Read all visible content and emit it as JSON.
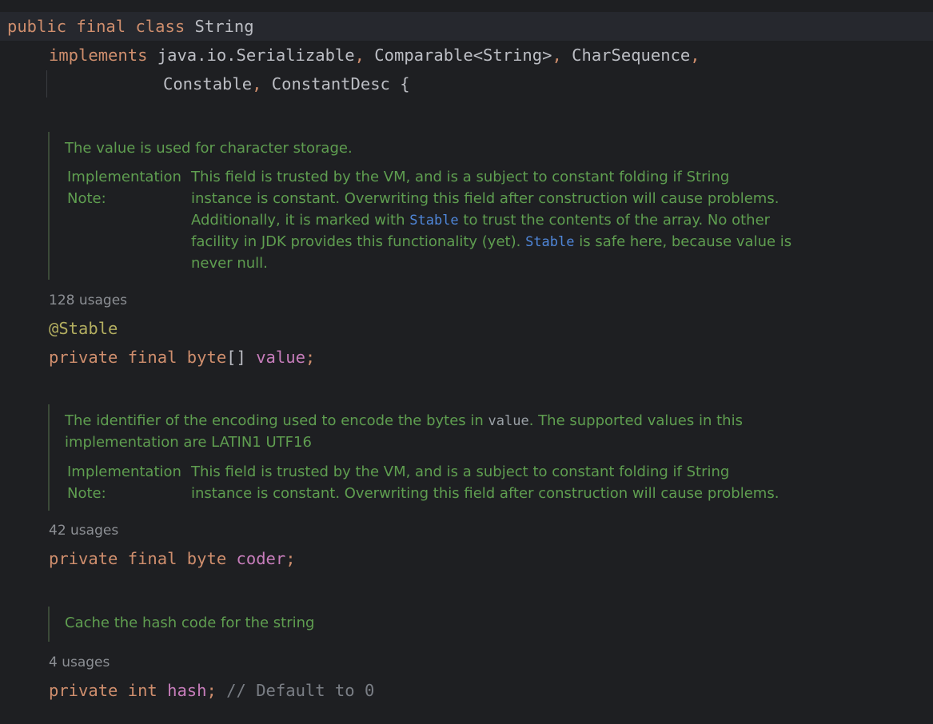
{
  "class_decl": {
    "line1": {
      "kw": "public final class",
      "name": "String"
    },
    "line2": {
      "kw": "implements",
      "types": [
        "java.io.Serializable",
        "Comparable<String>",
        "CharSequence"
      ],
      "comma": ","
    },
    "line3": {
      "types": [
        "Constable",
        "ConstantDesc"
      ],
      "comma": ",",
      "brace": "{"
    }
  },
  "doc_value": {
    "summary": "The value is used for character storage.",
    "impl_label_1": "Implementation",
    "impl_label_2": "Note:",
    "lines": [
      "This field is trusted by the VM, and is a subject to constant folding if String",
      "instance is constant. Overwriting this field after construction will cause problems."
    ],
    "line3_pre": "Additionally, it is marked with",
    "line3_link": "Stable",
    "line3_post": "to trust the contents of the array. No other",
    "line4_pre": "facility in JDK provides this functionality (yet).",
    "line4_link": "Stable",
    "line4_post": "is safe here, because value is",
    "line5": "never null."
  },
  "usages_value": "128 usages",
  "field_value": {
    "annotation": "@Stable",
    "kw": "private final",
    "type_kw": "byte",
    "brackets": "[]",
    "name": "value",
    "semi": ";"
  },
  "doc_coder": {
    "summary_pre": "The identifier of the encoding used to encode the bytes in",
    "summary_code": "value",
    "summary_post": ". The supported values in this",
    "summary_line2": "implementation are LATIN1 UTF16",
    "impl_label_1": "Implementation",
    "impl_label_2": "Note:",
    "lines": [
      "This field is trusted by the VM, and is a subject to constant folding if String",
      "instance is constant. Overwriting this field after construction will cause problems."
    ]
  },
  "usages_coder": "42 usages",
  "field_coder": {
    "kw": "private final byte",
    "name": "coder",
    "semi": ";"
  },
  "doc_hash": {
    "summary": "Cache the hash code for the string"
  },
  "usages_hash": "4 usages",
  "field_hash": {
    "kw": "private int",
    "name": "hash",
    "semi": ";",
    "comment": "// Default to 0"
  }
}
